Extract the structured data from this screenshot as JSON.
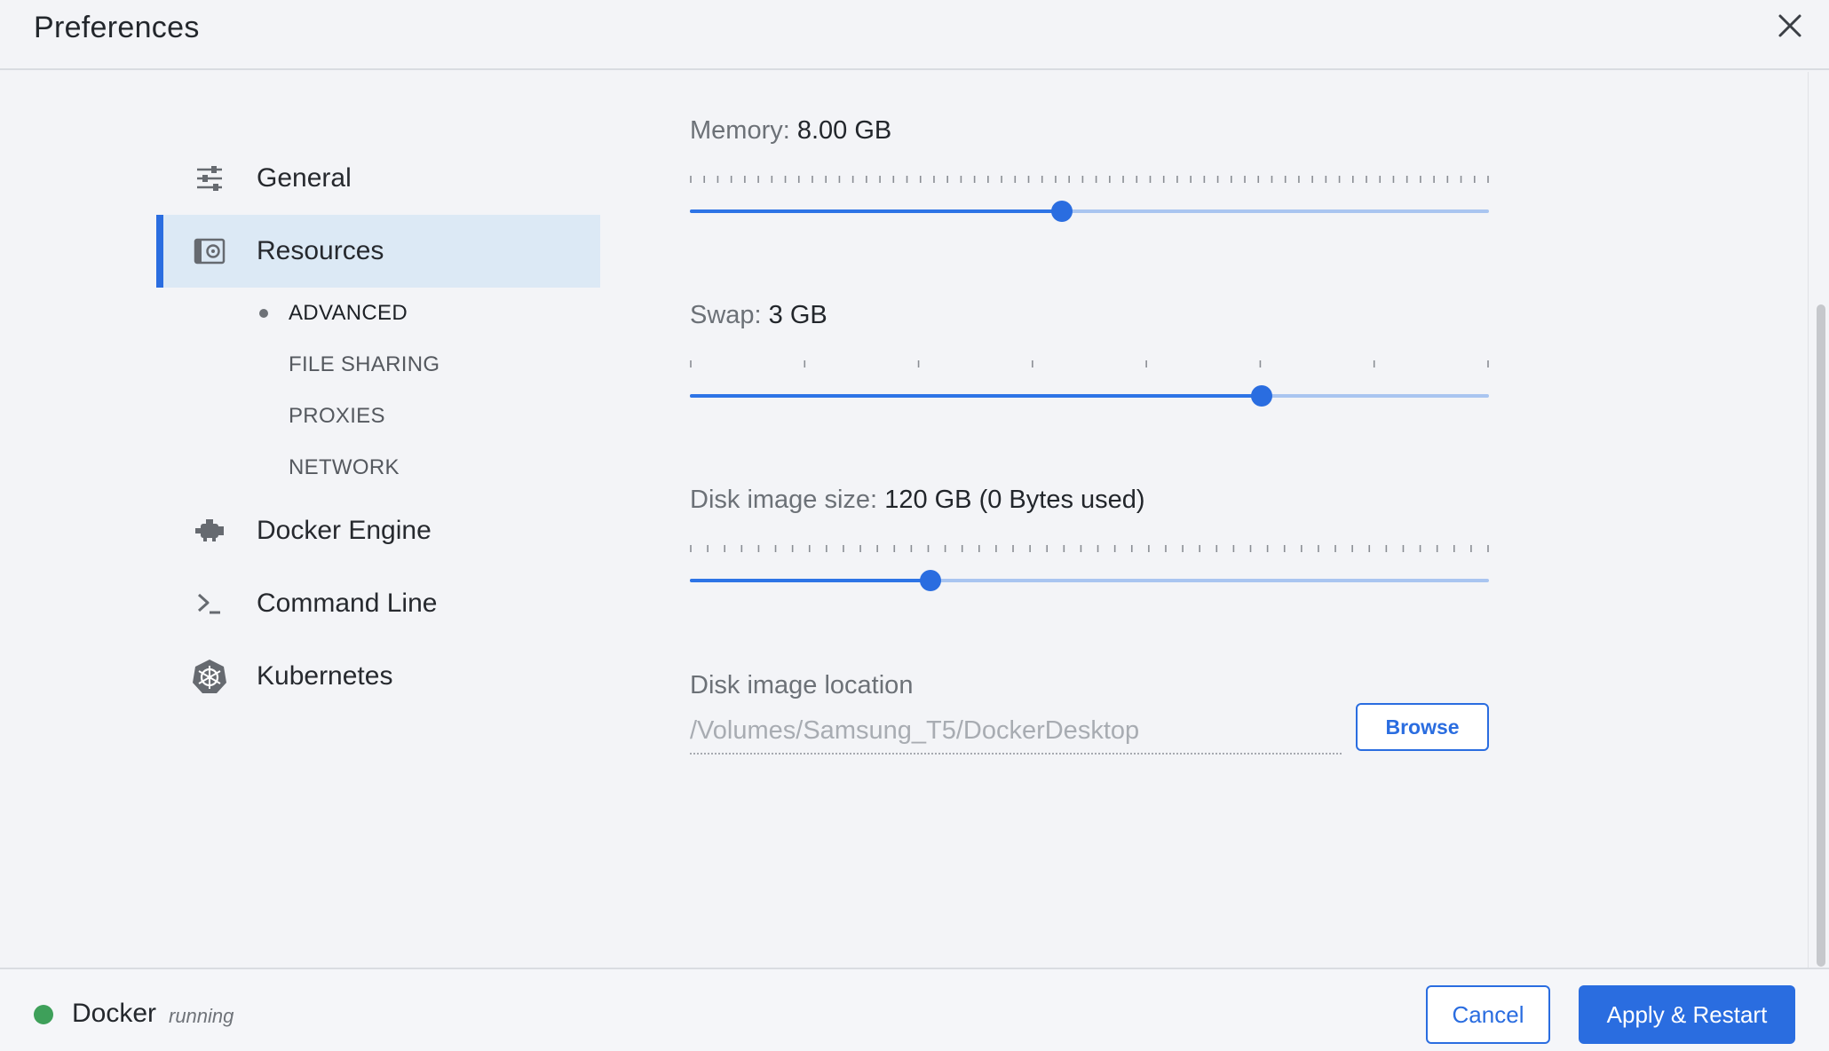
{
  "window": {
    "title": "Preferences"
  },
  "sidebar": {
    "items": [
      {
        "label": "General",
        "icon": "sliders-icon",
        "active": false
      },
      {
        "label": "Resources",
        "icon": "resources-icon",
        "active": true
      },
      {
        "label": "Docker Engine",
        "icon": "engine-icon",
        "active": false
      },
      {
        "label": "Command Line",
        "icon": "terminal-icon",
        "active": false
      },
      {
        "label": "Kubernetes",
        "icon": "kubernetes-icon",
        "active": false
      }
    ],
    "subitems": [
      {
        "label": "ADVANCED",
        "active": true
      },
      {
        "label": "FILE SHARING",
        "active": false
      },
      {
        "label": "PROXIES",
        "active": false
      },
      {
        "label": "NETWORK",
        "active": false
      }
    ]
  },
  "settings": {
    "memory": {
      "label": "Memory:",
      "value": "8.00 GB",
      "fraction": 0.466
    },
    "swap": {
      "label": "Swap:",
      "value": "3 GB",
      "fraction": 0.715
    },
    "disk_size": {
      "label": "Disk image size:",
      "value": "120 GB (0 Bytes used)",
      "fraction": 0.301
    },
    "disk_location": {
      "label": "Disk image location",
      "value": "/Volumes/Samsung_T5/DockerDesktop",
      "browse_label": "Browse"
    }
  },
  "footer": {
    "status_name": "Docker",
    "status_text": "running",
    "cancel_label": "Cancel",
    "apply_label": "Apply & Restart"
  },
  "colors": {
    "accent": "#2a6de0",
    "status_running": "#3ea05a"
  }
}
